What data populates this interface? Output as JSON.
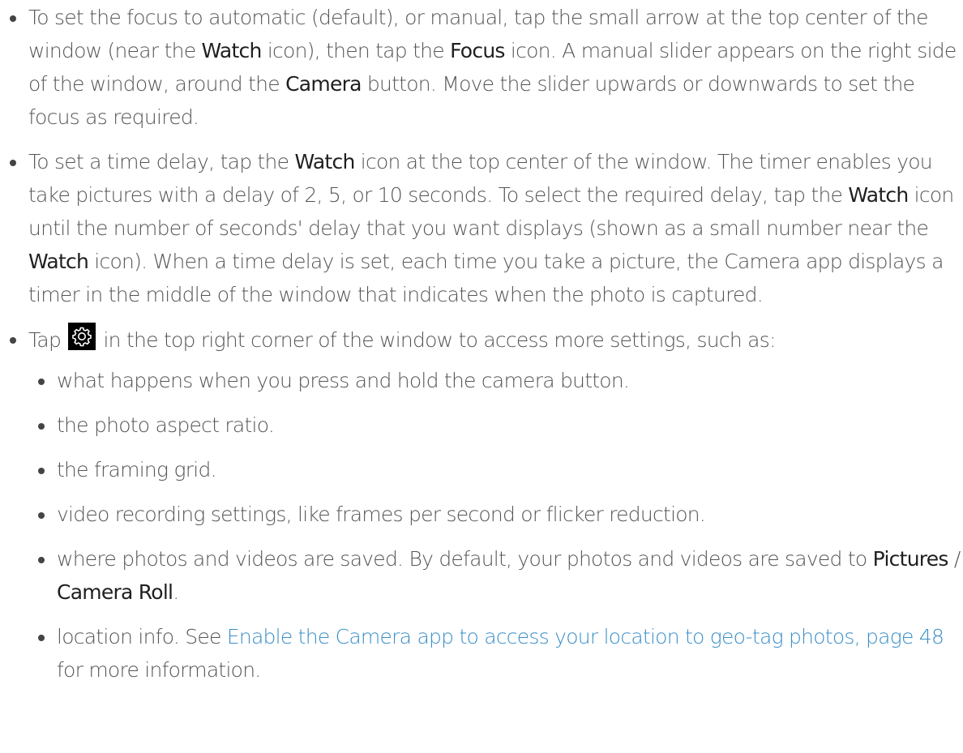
{
  "list": {
    "item1": {
      "t1": "To set the focus to automatic (default), or manual, tap the small arrow at the top center of the window (near the ",
      "b1": "Watch",
      "t2": " icon), then tap the ",
      "b2": "Focus",
      "t3": " icon. A manual slider appears on the right side of the window, around the ",
      "b3": "Camera",
      "t4": " button. Move the slider upwards or downwards to set the focus as required."
    },
    "item2": {
      "t1": "To set a time delay, tap the ",
      "b1": "Watch",
      "t2": " icon at the top center of the window. The timer enables you take pictures with a delay of 2, 5, or 10 seconds. To select the required delay, tap the ",
      "b2": "Watch",
      "t3": " icon until the number of seconds' delay that you want displays (shown as a small number near the ",
      "b3": "Watch",
      "t4": " icon). When a time delay is set, each time you take a picture, the Camera app displays a timer in the middle of the window that indicates when the photo is captured."
    },
    "item3": {
      "t1": "Tap ",
      "icon": "gear-icon",
      "t2": " in the top right corner of the window to access more settings, such as:"
    },
    "sub": [
      "what happens when you press and hold the camera button.",
      "the photo aspect ratio.",
      "the framing grid.",
      "video recording settings, like frames per second or flicker reduction."
    ],
    "sub5": {
      "t1": "where photos and videos are saved. By default, your photos and videos are saved to ",
      "b1": "Pictures",
      "t2": " / ",
      "b2": "Camera Roll",
      "t3": "."
    },
    "sub6": {
      "t1": "location info. See ",
      "link": "Enable the Camera app to access your location to geo-tag photos, page 48",
      "t2": " for more information."
    }
  },
  "colors": {
    "text": "#555555",
    "bold": "#1f1f1f",
    "link": "#3a8fc8"
  }
}
